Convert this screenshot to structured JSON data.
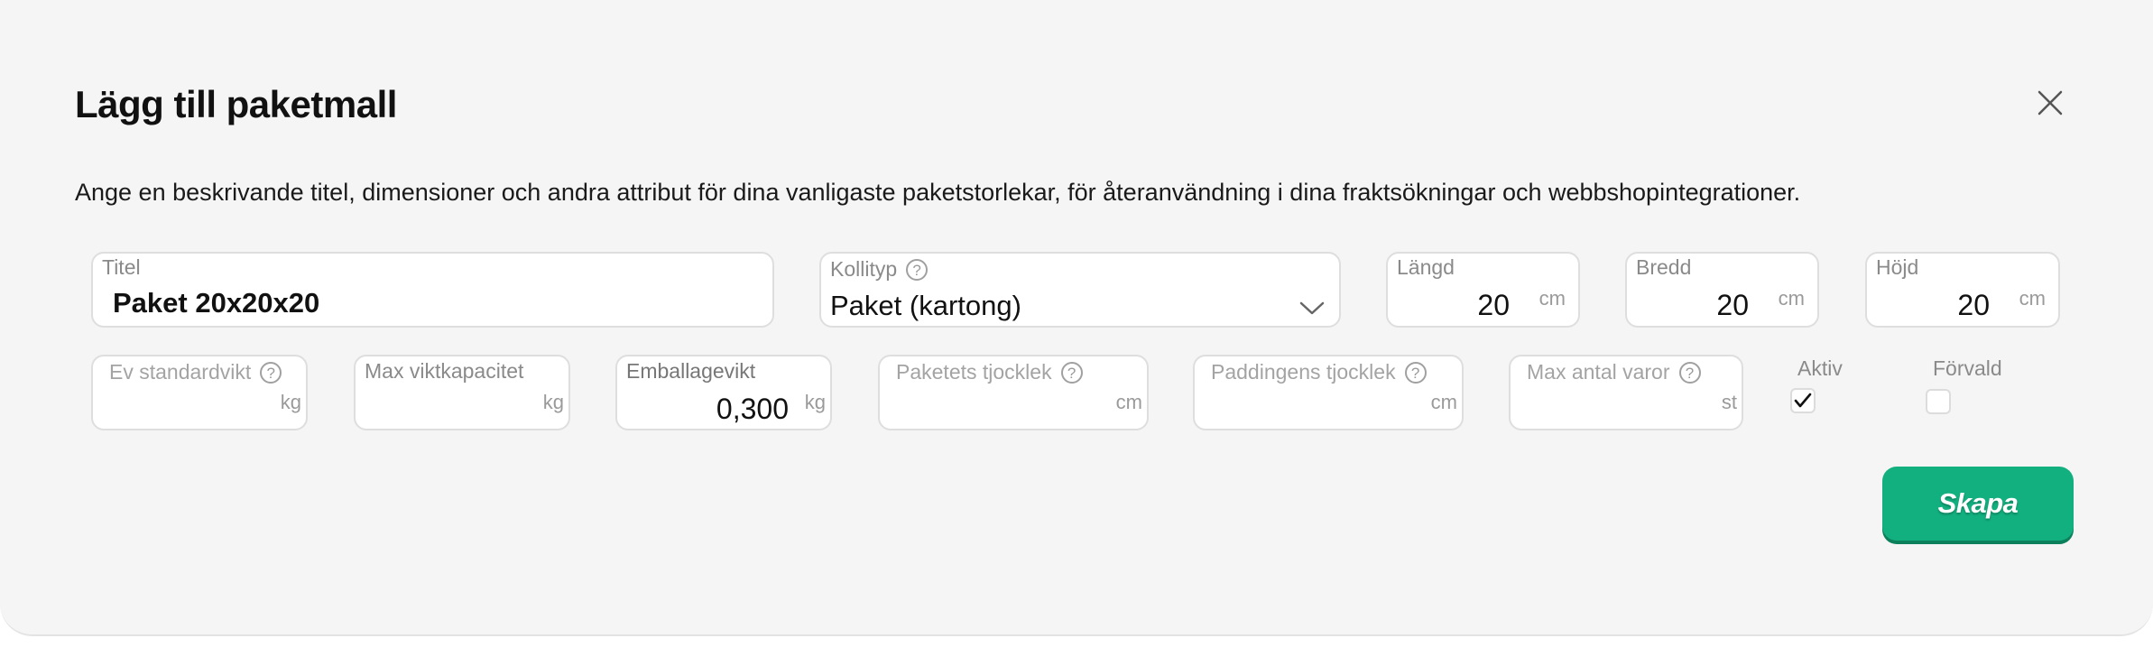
{
  "modal": {
    "title": "Lägg till paketmall",
    "description": "Ange en beskrivande titel, dimensioner och andra attribut för dina vanligaste paketstorlekar, för återanvändning i dina fraktsökningar och webbshopintegrationer.",
    "close_icon": "close-icon"
  },
  "row1": {
    "titel": {
      "label": "Titel",
      "value": "Paket 20x20x20"
    },
    "kollityp": {
      "label": "Kollityp",
      "value": "Paket (kartong)",
      "help": "?"
    },
    "langd": {
      "label": "Längd",
      "value": "20",
      "unit": "cm"
    },
    "bredd": {
      "label": "Bredd",
      "value": "20",
      "unit": "cm"
    },
    "hojd": {
      "label": "Höjd",
      "value": "20",
      "unit": "cm"
    }
  },
  "row2": {
    "standardvikt": {
      "label": "Ev standardvikt",
      "value": "",
      "unit": "kg",
      "help": "?"
    },
    "maxvikt": {
      "label": "Max viktkapacitet",
      "value": "",
      "unit": "kg"
    },
    "emballagevikt": {
      "label": "Emballagevikt",
      "value": "0,300",
      "unit": "kg"
    },
    "paketets_tjocklek": {
      "label": "Paketets tjocklek",
      "value": "",
      "unit": "cm",
      "help": "?"
    },
    "paddingens_tjocklek": {
      "label": "Paddingens tjocklek",
      "value": "",
      "unit": "cm",
      "help": "?"
    },
    "max_antal_varor": {
      "label": "Max antal varor",
      "value": "",
      "unit": "st",
      "help": "?"
    },
    "aktiv": {
      "label": "Aktiv",
      "checked": true
    },
    "forvald": {
      "label": "Förvald",
      "checked": false
    }
  },
  "actions": {
    "create_label": "Skapa"
  },
  "colors": {
    "accent": "#12b07f",
    "background": "#f5f5f5",
    "border": "#dedede"
  }
}
